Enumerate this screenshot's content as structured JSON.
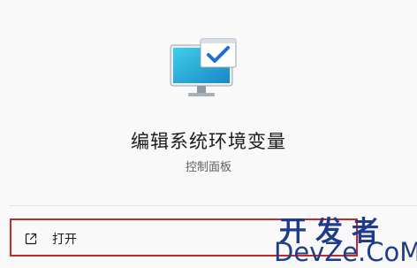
{
  "app": {
    "icon": "control-panel-monitor-check-icon",
    "title": "编辑系统环境变量",
    "subtitle": "控制面板"
  },
  "actions": [
    {
      "icon": "open-external-icon",
      "label": "打开"
    }
  ],
  "watermark": {
    "top": "开发者",
    "bottom": "DevZe.CoM"
  },
  "colors": {
    "highlight_border": "#c62828",
    "watermark": "#1f3c8c",
    "monitor_screen": "#29a9d4",
    "check_badge": "#1f6fd6"
  }
}
